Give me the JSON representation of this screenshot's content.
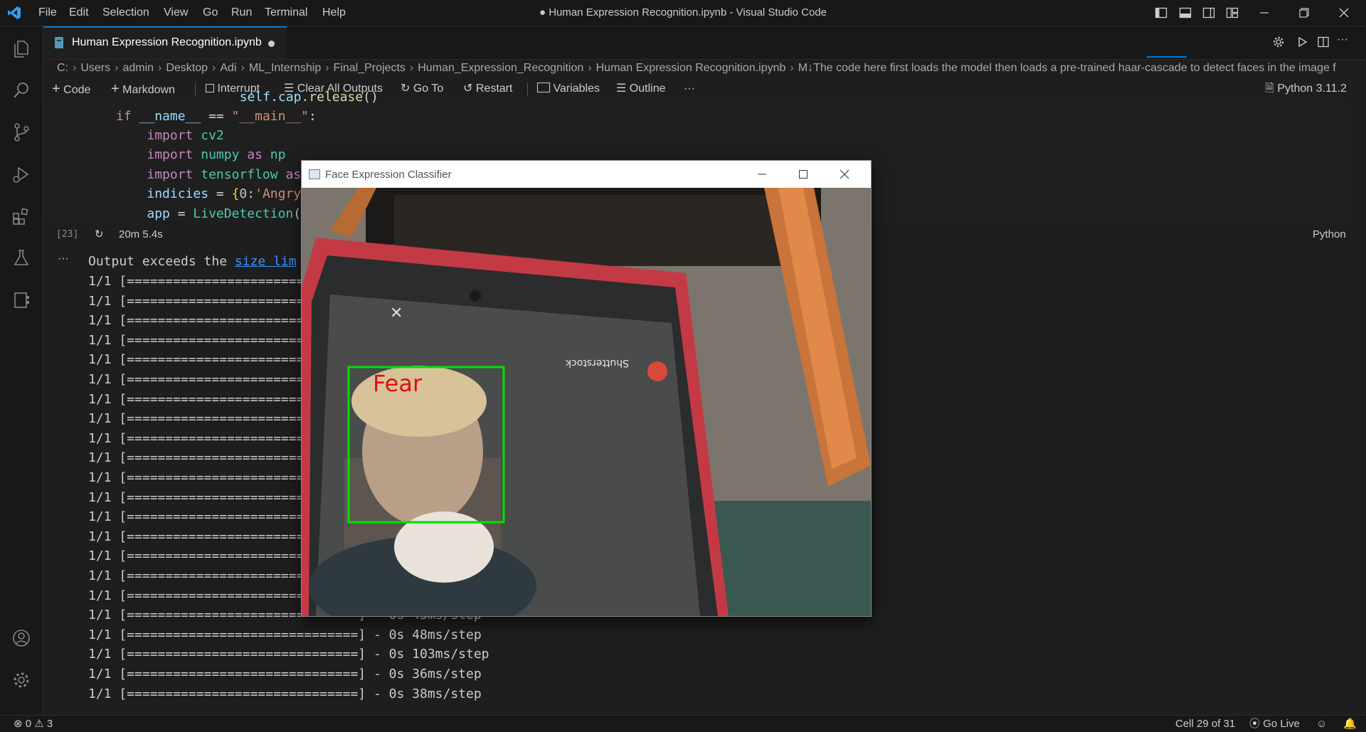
{
  "window_title": "● Human Expression Recognition.ipynb - Visual Studio Code",
  "menu": [
    "File",
    "Edit",
    "Selection",
    "View",
    "Go",
    "Run",
    "Terminal",
    "Help"
  ],
  "tab": {
    "label": "Human Expression Recognition.ipynb"
  },
  "breadcrumb": [
    "C:",
    "Users",
    "admin",
    "Desktop",
    "Adi",
    "ML_Internship",
    "Final_Projects",
    "Human_Expression_Recognition",
    "Human Expression Recognition.ipynb",
    "M↓The code here first loads the model then loads a pre-trained haar-cascade to detect faces in the image f"
  ],
  "toolbar": {
    "code": "Code",
    "markdown": "Markdown",
    "interrupt": "Interrupt",
    "clear_outputs": "Clear All Outputs",
    "go_to": "Go To",
    "restart": "Restart",
    "variables": "Variables",
    "outline": "Outline",
    "more": "···",
    "kernel": "Python 3.11.2"
  },
  "code_lines": [
    {
      "t": "        self.cap.release()"
    },
    {
      "t": "if __name__ == \"__main__\":"
    },
    {
      "t": "    import cv2"
    },
    {
      "t": "    import numpy as np"
    },
    {
      "t": "    import tensorflow as"
    },
    {
      "t": "    indicies = {0:'Angry"
    },
    {
      "t": "    app = LiveDetection("
    }
  ],
  "cell": {
    "exec_count": "[23]",
    "duration": "20m 5.4s",
    "language": "Python",
    "more": "···"
  },
  "output": {
    "notice_prefix": "Output exceeds the ",
    "notice_link": "size lim",
    "bar": "1/1 [==============================]",
    "full_lines": [
      "1/1 [==============================] - 0s 43ms/step",
      "1/1 [==============================] - 0s 48ms/step",
      "1/1 [==============================] - 0s 103ms/step",
      "1/1 [==============================] - 0s 36ms/step",
      "1/1 [==============================] - 0s 38ms/step"
    ]
  },
  "popup": {
    "title": "Face Expression Classifier",
    "detection_label": "Fear",
    "phone_app_label": "Shutterstock"
  },
  "status": {
    "errors": "0",
    "warnings": "3",
    "cell_position": "Cell 29 of 31",
    "go_live": "Go Live"
  },
  "colors": {
    "accent": "#0078d4",
    "detection_box": "#00e000",
    "detection_label": "#e01010"
  }
}
